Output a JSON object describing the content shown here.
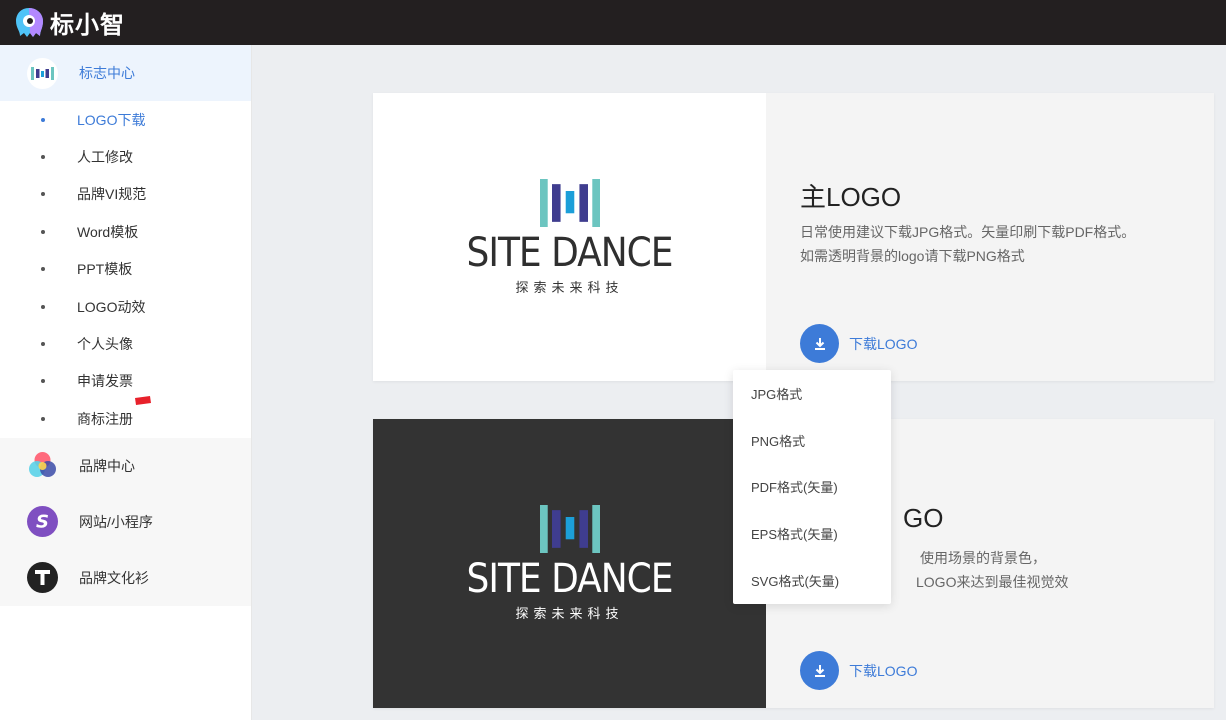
{
  "app": {
    "name": "标小智"
  },
  "sidebar": {
    "logo_center": {
      "label": "标志中心",
      "items": [
        {
          "label": "LOGO下载",
          "active": true
        },
        {
          "label": "人工修改"
        },
        {
          "label": "品牌VI规范"
        },
        {
          "label": "Word模板"
        },
        {
          "label": "PPT模板"
        },
        {
          "label": "LOGO动效"
        },
        {
          "label": "个人头像"
        },
        {
          "label": "申请发票"
        },
        {
          "label": "商标注册"
        }
      ]
    },
    "sections": [
      {
        "label": "品牌中心",
        "icon": "color-circles-icon"
      },
      {
        "label": "网站/小程序",
        "icon": "s-letter-icon"
      },
      {
        "label": "品牌文化衫",
        "icon": "t-letter-icon"
      }
    ]
  },
  "preview": {
    "brand_name": "SITE DANCE",
    "slogan": "探索未来科技"
  },
  "cards": [
    {
      "title": "主LOGO",
      "desc_line1": "日常使用建议下载JPG格式。矢量印刷下载PDF格式。",
      "desc_line2": "如需透明背景的logo请下载PNG格式",
      "download_label": "下载LOGO"
    },
    {
      "title_suffix": "GO",
      "desc_line1": "使用场景的背景色，",
      "desc_line2": "LOGO来达到最佳视觉效",
      "download_label": "下载LOGO"
    }
  ],
  "dropdown": {
    "options": [
      "JPG格式",
      "PNG格式",
      "PDF格式(矢量)",
      "EPS格式(矢量)",
      "SVG格式(矢量)"
    ]
  },
  "colors": {
    "accent": "#3d7bd8",
    "topbar": "#231f20",
    "teal": "#6cc5c0",
    "indigo": "#3f3d8f",
    "blue": "#1c9fd9"
  }
}
